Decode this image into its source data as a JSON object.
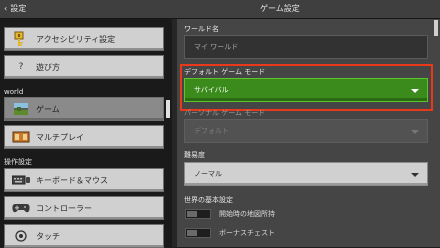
{
  "header": {
    "back_label": "設定",
    "title": "ゲーム設定"
  },
  "left": {
    "items_top": [
      {
        "label": "アクセシビリティ設定",
        "icon": "key-icon"
      },
      {
        "label": "遊び方",
        "icon": "question-icon",
        "glyph": "?"
      }
    ],
    "world_section": "world",
    "world_items": [
      {
        "label": "ゲーム",
        "icon": "world-icon",
        "active": true
      },
      {
        "label": "マルチプレイ",
        "icon": "multiplayer-icon"
      }
    ],
    "controls_section": "操作設定",
    "control_items": [
      {
        "label": "キーボード＆マウス",
        "icon": "keyboard-icon"
      },
      {
        "label": "コントローラー",
        "icon": "controller-icon"
      },
      {
        "label": "タッチ",
        "icon": "touch-icon"
      }
    ]
  },
  "right": {
    "world_name_label": "ワールド名",
    "world_name_value": "マイ ワールド",
    "default_mode_label": "デフォルト ゲーム モード",
    "default_mode_value": "サバイバル",
    "personal_mode_label": "パーソナル ゲーム モード",
    "personal_mode_value": "デフォルト",
    "difficulty_label": "難易度",
    "difficulty_value": "ノーマル",
    "world_basics_label": "世界の基本設定",
    "toggles": [
      {
        "label": "開始時の地図所持",
        "on": false
      },
      {
        "label": "ボーナスチェスト",
        "on": false
      }
    ]
  },
  "colors": {
    "highlight": "#e83a1a",
    "accent_green": "#3a8a1c"
  }
}
